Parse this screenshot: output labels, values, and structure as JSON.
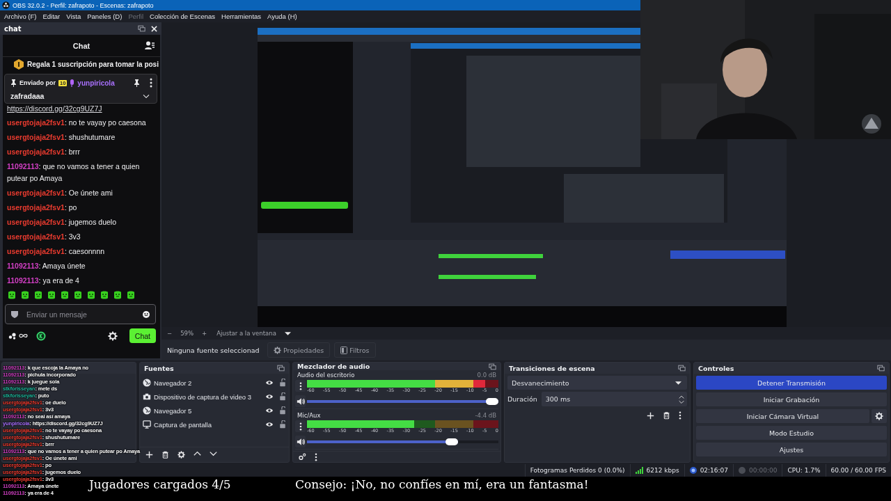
{
  "window": {
    "title": "OBS 32.0.2 - Perfil: zafrapoto - Escenas: zafrapoto"
  },
  "menu": [
    {
      "label": "Archivo (F)",
      "disabled": false
    },
    {
      "label": "Editar",
      "disabled": false
    },
    {
      "label": "Vista",
      "disabled": false
    },
    {
      "label": "Paneles (D)",
      "disabled": false
    },
    {
      "label": "Perfil",
      "disabled": true
    },
    {
      "label": "Colección de Escenas",
      "disabled": false
    },
    {
      "label": "Herramientas",
      "disabled": false
    },
    {
      "label": "Ayuda (H)",
      "disabled": false
    }
  ],
  "chat_dock": {
    "title": "chat",
    "header": "Chat",
    "banner": "Regala 1 suscripción para tomar la posi",
    "pinned": {
      "sent_by": "Enviado por",
      "badge": "10",
      "user": "yunpiricola",
      "color": "#a970ff",
      "text": "zafradaaa"
    },
    "link": "https://discord.gg/32cg9UZ7J",
    "messages": [
      {
        "user": "usergtojaja2fsv1",
        "color": "#eb3b2f",
        "text": ": no te vayay po caesona"
      },
      {
        "user": "usergtojaja2fsv1",
        "color": "#eb3b2f",
        "text": ": shushutumare"
      },
      {
        "user": "usergtojaja2fsv1",
        "color": "#eb3b2f",
        "text": ": brrr"
      },
      {
        "user": "11092113",
        "color": "#d23fc4",
        "text": ": que no vamos a tener a quien putear po Amaya"
      },
      {
        "user": "usergtojaja2fsv1",
        "color": "#eb3b2f",
        "text": ": Oe únete ami"
      },
      {
        "user": "usergtojaja2fsv1",
        "color": "#eb3b2f",
        "text": ": po"
      },
      {
        "user": "usergtojaja2fsv1",
        "color": "#eb3b2f",
        "text": ": jugemos duelo"
      },
      {
        "user": "usergtojaja2fsv1",
        "color": "#eb3b2f",
        "text": ": 3v3"
      },
      {
        "user": "usergtojaja2fsv1",
        "color": "#eb3b2f",
        "text": ": caesonnnn"
      },
      {
        "user": "11092113",
        "color": "#d23fc4",
        "text": ": Amaya únete"
      },
      {
        "user": "11092113",
        "color": "#d23fc4",
        "text": ": ya era de 4"
      }
    ],
    "input": {
      "placeholder": "Enviar un mensaje"
    },
    "send_button": "Chat"
  },
  "preview": {
    "kind": "picture"
  },
  "zoom_bar": {
    "minus": "−",
    "zoom": "59%",
    "plus": "+",
    "fit": "Ajustar a la ventana"
  },
  "properties_bar": {
    "selection": "Ninguna fuente seleccionad",
    "buttons": [
      "Propiedades",
      "Filtros"
    ]
  },
  "sources": {
    "title": "Fuentes",
    "items": [
      {
        "label": "Navegador 2",
        "kind": "browser",
        "visible": true,
        "locked": false
      },
      {
        "label": "Dispositivo de captura de video 3",
        "kind": "camera",
        "visible": true,
        "locked": false
      },
      {
        "label": "Navegador 5",
        "kind": "browser",
        "visible": true,
        "locked": false
      },
      {
        "label": "Captura de pantalla",
        "kind": "screen",
        "visible": true,
        "locked": false
      }
    ]
  },
  "mixer": {
    "title": "Mezclador de audio",
    "channels": [
      {
        "name": "Audio del escritorio",
        "reading": "0.0 dB",
        "level": 0.93,
        "volume": {
          "level": 1.0
        },
        "scale": [
          "-60",
          "-55",
          "-50",
          "-45",
          "-40",
          "-35",
          "-30",
          "-25",
          "-20",
          "-15",
          "-10",
          "-5",
          "0"
        ]
      },
      {
        "name": "Mic/Aux",
        "reading": "-4.4 dB",
        "level": 0.56,
        "volume": {
          "level": 0.79
        },
        "scale": [
          "-60",
          "-55",
          "-50",
          "-45",
          "-40",
          "-35",
          "-30",
          "-25",
          "-20",
          "-15",
          "-10",
          "-5",
          "0"
        ]
      }
    ]
  },
  "transitions": {
    "title": "Transiciones de escena",
    "transition": "Desvanecimiento",
    "duration_label": "Duración",
    "duration": "300 ms"
  },
  "controls": {
    "title": "Controles",
    "buttons": [
      {
        "label": "Detener Transmisión",
        "active": true,
        "kind": "plain"
      },
      {
        "label": "Iniciar Grabación",
        "active": false,
        "kind": "plain"
      },
      {
        "label": "Iniciar Cámara Virtual",
        "active": false,
        "kind": "with-settings"
      },
      {
        "label": "Modo Estudio",
        "active": false,
        "kind": "plain"
      },
      {
        "label": "Ajustes",
        "active": false,
        "kind": "plain"
      }
    ]
  },
  "status_bar": [
    {
      "kind": "text",
      "text": "Fotogramas Perdidos 0 (0.0%)"
    },
    {
      "kind": "bitrate",
      "text": "6212 kbps"
    },
    {
      "kind": "stream",
      "text": "02:16:07",
      "active": true
    },
    {
      "kind": "record",
      "text": "00:00:00",
      "active": false
    },
    {
      "kind": "text",
      "text": "CPU: 1.7%"
    },
    {
      "kind": "text",
      "text": "60.00 / 60.00 FPS"
    }
  ],
  "stream_overlay_chat": [
    {
      "user": "11092113",
      "color": "#d23fc4",
      "text": ": k que escoja la Amaya no"
    },
    {
      "user": "11092113",
      "color": "#d23fc4",
      "text": ": pichula incorporado"
    },
    {
      "user": "11092113",
      "color": "#d23fc4",
      "text": ": k juegue sola"
    },
    {
      "user": "stkforisseyan",
      "color": "#1fb59a",
      "text": ": mete ds"
    },
    {
      "user": "stkforisseyan",
      "color": "#1fb59a",
      "text": ": puto"
    },
    {
      "user": "usergtojaja2fsv1",
      "color": "#eb3b2f",
      "text": ": oe duelo"
    },
    {
      "user": "usergtojaja2fsv1",
      "color": "#eb3b2f",
      "text": ": 3v3"
    },
    {
      "user": "11092113",
      "color": "#d23fc4",
      "text": ": no seai así amaya"
    },
    {
      "user": "yunpiricola",
      "color": "#a970ff",
      "text": ": https://discord.gg/32cg9UZ7J"
    },
    {
      "user": "usergtojaja2fsv1",
      "color": "#eb3b2f",
      "text": ": no te vayay po caesona"
    },
    {
      "user": "usergtojaja2fsv1",
      "color": "#eb3b2f",
      "text": ": shushutumare"
    },
    {
      "user": "usergtojaja2fsv1",
      "color": "#eb3b2f",
      "text": ": brrr"
    },
    {
      "user": "11092113",
      "color": "#d23fc4",
      "text": ": que no vamos a tener a quien putear po Amaya"
    },
    {
      "user": "usergtojaja2fsv1",
      "color": "#eb3b2f",
      "text": ": Oe únete ami"
    },
    {
      "user": "usergtojaja2fsv1",
      "color": "#eb3b2f",
      "text": ": po"
    },
    {
      "user": "usergtojaja2fsv1",
      "color": "#eb3b2f",
      "text": ": jugemos duelo"
    },
    {
      "user": "usergtojaja2fsv1",
      "color": "#eb3b2f",
      "text": ": 3v3"
    },
    {
      "user": "11092113",
      "color": "#d23fc4",
      "text": ": Amaya únete"
    },
    {
      "user": "11092113",
      "color": "#d23fc4",
      "text": ": ya era de 4"
    }
  ],
  "subtitles": [
    "Jugadores cargados 4/5",
    "Consejo: ¡No, no confíes en mí, era un fantasma!"
  ],
  "webcam": {
    "kind": "picture"
  }
}
